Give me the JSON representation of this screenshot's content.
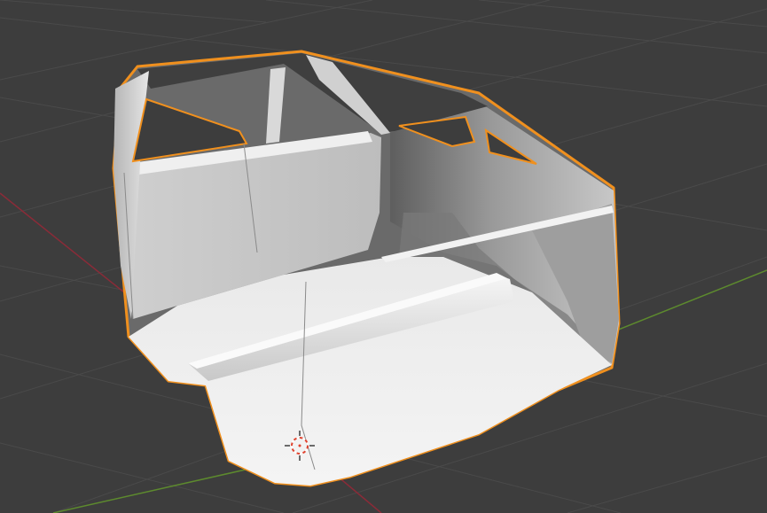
{
  "viewport": {
    "mode": "3D Viewport",
    "background": "#3d3d3d",
    "grid_color": "#4a4a4a",
    "x_axis_color": "#8a2b38",
    "y_axis_color": "#5d8a2e"
  },
  "selection": {
    "outline_color": "#f0901e",
    "object": "car-interior-shell"
  },
  "cursor": {
    "type": "3d-cursor",
    "colors": [
      "#e0432f",
      "#ffffff"
    ]
  }
}
